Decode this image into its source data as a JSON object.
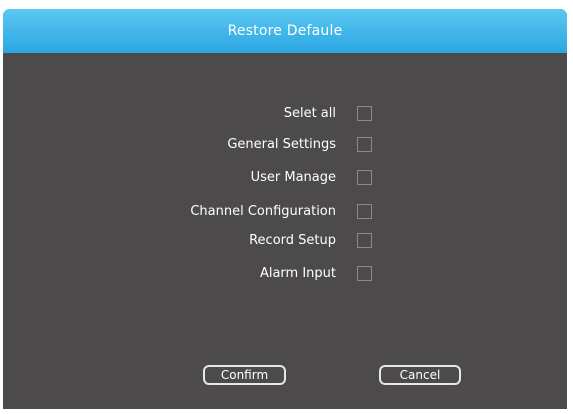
{
  "dialog": {
    "title": "Restore Defaule"
  },
  "options": [
    {
      "label": "Selet all",
      "checked": false
    },
    {
      "label": "General Settings",
      "checked": false
    },
    {
      "label": "User Manage",
      "checked": false
    },
    {
      "label": "Channel Configuration",
      "checked": false
    },
    {
      "label": "Record Setup",
      "checked": false
    },
    {
      "label": "Alarm Input",
      "checked": false
    }
  ],
  "buttons": {
    "confirm_label": "Confirm",
    "cancel_label": "Cancel"
  },
  "colors": {
    "title_bar": "#2ba6e2",
    "panel_background": "#4c4a4b",
    "text": "#ffffff"
  }
}
